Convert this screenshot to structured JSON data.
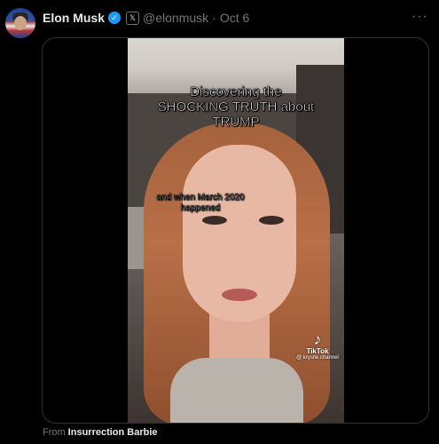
{
  "post": {
    "author_name": "Elon Musk",
    "handle": "@elonmusk",
    "separator": "·",
    "date": "Oct 6",
    "verified_icon": "verified-checkmark-icon",
    "org_badge_icon": "x-logo-icon",
    "more_icon": "more-horizontal-icon"
  },
  "video": {
    "caption_main": "Discovering the\nSHOCKING TRUTH about\nTRUMP",
    "caption_sub": "and when March 2020\nhappened",
    "watermark_label": "TikTok",
    "watermark_handle": "@ krystle.channel",
    "watermark_icon": "tiktok-logo-icon"
  },
  "attribution": {
    "prefix": "From",
    "source": "Insurrection Barbie"
  },
  "colors": {
    "background": "#000000",
    "verified": "#1d9bf0",
    "muted_text": "#71767b",
    "primary_text": "#e7e9ea"
  }
}
